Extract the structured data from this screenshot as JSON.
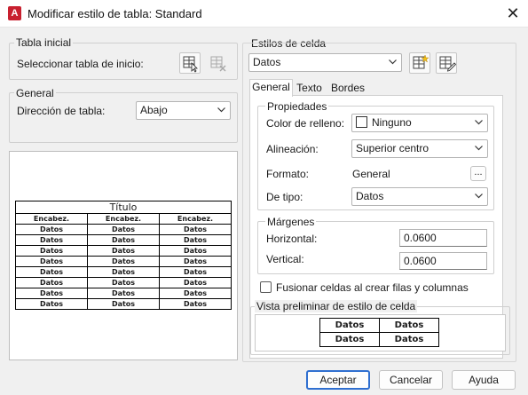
{
  "window": {
    "title": "Modificar estilo de tabla: Standard",
    "app_icon_letter": "A"
  },
  "tabla_inicial": {
    "group_label": "Tabla inicial",
    "select_label": "Seleccionar tabla de inicio:"
  },
  "general_group": {
    "group_label": "General",
    "direction_label": "Dirección de tabla:",
    "direction_value": "Abajo"
  },
  "preview_table": {
    "title": "Título",
    "headers": [
      "Encabez.",
      "Encabez.",
      "Encabez."
    ],
    "rows": [
      [
        "Datos",
        "Datos",
        "Datos"
      ],
      [
        "Datos",
        "Datos",
        "Datos"
      ],
      [
        "Datos",
        "Datos",
        "Datos"
      ],
      [
        "Datos",
        "Datos",
        "Datos"
      ],
      [
        "Datos",
        "Datos",
        "Datos"
      ],
      [
        "Datos",
        "Datos",
        "Datos"
      ],
      [
        "Datos",
        "Datos",
        "Datos"
      ],
      [
        "Datos",
        "Datos",
        "Datos"
      ]
    ]
  },
  "cell_styles": {
    "group_label": "Estilos de celda",
    "selected": "Datos"
  },
  "tabs": [
    {
      "label": "General",
      "active": true
    },
    {
      "label": "Texto",
      "active": false
    },
    {
      "label": "Bordes",
      "active": false
    }
  ],
  "properties": {
    "group_label": "Propiedades",
    "fill_color_label": "Color de relleno:",
    "fill_color_value": "Ninguno",
    "alignment_label": "Alineación:",
    "alignment_value": "Superior centro",
    "format_label": "Formato:",
    "format_value": "General",
    "format_button": "...",
    "type_label": "De tipo:",
    "type_value": "Datos"
  },
  "margins": {
    "group_label": "Márgenes",
    "horizontal_label": "Horizontal:",
    "horizontal_value": "0.0600",
    "vertical_label": "Vertical:",
    "vertical_value": "0.0600"
  },
  "merge_checkbox": {
    "label": "Fusionar celdas al crear filas y columnas",
    "checked": false
  },
  "cell_preview": {
    "group_label": "Vista preliminar de estilo de celda",
    "cells": [
      [
        "Datos",
        "Datos"
      ],
      [
        "Datos",
        "Datos"
      ]
    ]
  },
  "buttons": {
    "accept": "Aceptar",
    "cancel": "Cancelar",
    "help": "Ayuda"
  },
  "colors": {
    "app_icon": "#c8202f",
    "primary_border": "#2f6fd0"
  }
}
